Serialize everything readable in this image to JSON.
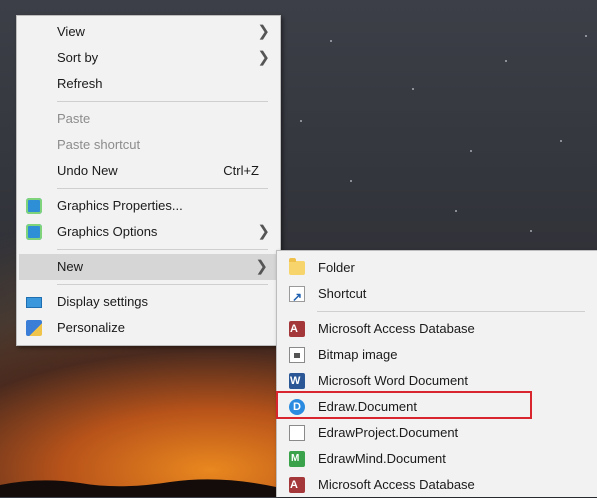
{
  "context_menu": {
    "items": [
      {
        "label": "View",
        "submenu": true
      },
      {
        "label": "Sort by",
        "submenu": true
      },
      {
        "label": "Refresh"
      },
      {
        "label": "Paste",
        "disabled": true
      },
      {
        "label": "Paste shortcut",
        "disabled": true
      },
      {
        "label": "Undo New",
        "shortcut": "Ctrl+Z"
      },
      {
        "label": "Graphics Properties...",
        "icon": "graphics-icon"
      },
      {
        "label": "Graphics Options",
        "icon": "graphics-icon",
        "submenu": true
      },
      {
        "label": "New",
        "submenu": true,
        "highlighted": true
      },
      {
        "label": "Display settings",
        "icon": "display-icon"
      },
      {
        "label": "Personalize",
        "icon": "personalize-icon"
      }
    ]
  },
  "new_submenu": {
    "items": [
      {
        "label": "Folder",
        "icon": "folder-icon"
      },
      {
        "label": "Shortcut",
        "icon": "shortcut-icon"
      },
      {
        "label": "Microsoft Access Database",
        "icon": "access-icon"
      },
      {
        "label": "Bitmap image",
        "icon": "bitmap-icon"
      },
      {
        "label": "Microsoft Word Document",
        "icon": "word-icon"
      },
      {
        "label": "Edraw.Document",
        "icon": "edraw-icon",
        "annotated": true
      },
      {
        "label": "EdrawProject.Document",
        "icon": "document-icon"
      },
      {
        "label": "EdrawMind.Document",
        "icon": "edrawmind-icon"
      },
      {
        "label": "Microsoft Access Database",
        "icon": "access-icon"
      }
    ]
  },
  "colors": {
    "annotation": "#d9262e",
    "menu_background": "#f2f2f2",
    "highlight": "#d6d6d6",
    "disabled_text": "#8c8c8c"
  }
}
